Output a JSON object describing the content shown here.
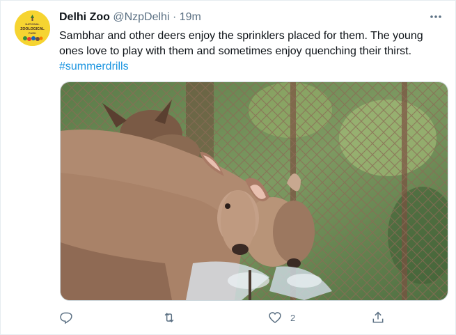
{
  "tweet": {
    "author_name": "Delhi Zoo",
    "handle": "@NzpDelhi",
    "separator": "·",
    "time": "19m",
    "text": "Sambhar and other deers enjoy the sprinklers placed for them. The young ones love to play with them and sometimes enjoy quenching their thirst.",
    "hashtag": "#summerdrills",
    "avatar_text": [
      "NATIONAL",
      "ZOOLOGICAL",
      "PARK"
    ],
    "like_count": "2",
    "accent_color": "#1b95e0",
    "avatar_color": "#f6d431"
  },
  "actions": {
    "reply_icon": "reply-icon",
    "retweet_icon": "retweet-icon",
    "like_icon": "heart-icon",
    "share_icon": "share-icon"
  }
}
